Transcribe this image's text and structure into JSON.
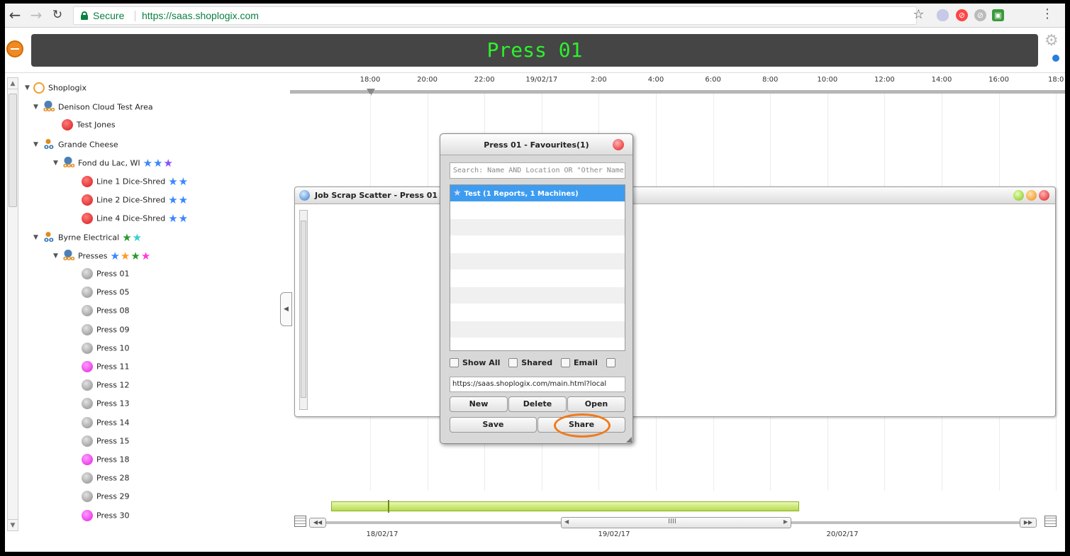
{
  "browser": {
    "secure_label": "Secure",
    "url": "https://saas.shoplogix.com",
    "icons": [
      "back-arrow-icon",
      "forward-arrow-icon",
      "reload-icon",
      "lock-icon",
      "star-icon",
      "menu-icon"
    ]
  },
  "header": {
    "title": "Press 01",
    "title_color": "#2cf22c",
    "bar_color": "#454545"
  },
  "tree": [
    {
      "label": "Shoplogix",
      "icon": "company-icon",
      "toggle": "▼",
      "stars": []
    },
    {
      "label": "Denison Cloud Test Area",
      "icon": "area-icon",
      "toggle": "▼",
      "stars": []
    },
    {
      "label": "Test Jones",
      "icon": "red-status-icon",
      "toggle": "",
      "stars": []
    },
    {
      "label": "Grande Cheese",
      "icon": "group-icon",
      "toggle": "▼",
      "stars": []
    },
    {
      "label": "Fond du Lac, WI",
      "icon": "area-icon",
      "toggle": "▼",
      "stars": [
        "blue",
        "blue",
        "violet"
      ]
    },
    {
      "label": "Line 1 Dice-Shred",
      "icon": "red-status-icon",
      "toggle": "",
      "stars": [
        "blue",
        "blue"
      ]
    },
    {
      "label": "Line 2 Dice-Shred",
      "icon": "red-status-icon",
      "toggle": "",
      "stars": [
        "blue",
        "blue"
      ]
    },
    {
      "label": "Line 4 Dice-Shred",
      "icon": "red-status-icon",
      "toggle": "",
      "stars": [
        "blue",
        "blue"
      ]
    },
    {
      "label": "Byrne Electrical",
      "icon": "group-icon",
      "toggle": "▼",
      "stars": [
        "green",
        "cyan"
      ]
    },
    {
      "label": "Presses",
      "icon": "area-icon",
      "toggle": "▼",
      "stars": [
        "blue",
        "orange",
        "green",
        "pink"
      ]
    },
    {
      "label": "Press 01",
      "icon": "gray-status-icon",
      "toggle": "",
      "stars": []
    },
    {
      "label": "Press 05",
      "icon": "gray-status-icon",
      "toggle": "",
      "stars": []
    },
    {
      "label": "Press 08",
      "icon": "gray-status-icon",
      "toggle": "",
      "stars": []
    },
    {
      "label": "Press 09",
      "icon": "gray-status-icon",
      "toggle": "",
      "stars": []
    },
    {
      "label": "Press 10",
      "icon": "gray-status-icon",
      "toggle": "",
      "stars": []
    },
    {
      "label": "Press 11",
      "icon": "pink-status-icon",
      "toggle": "",
      "stars": []
    },
    {
      "label": "Press 12",
      "icon": "gray-status-icon",
      "toggle": "",
      "stars": []
    },
    {
      "label": "Press 13",
      "icon": "gray-status-icon",
      "toggle": "",
      "stars": []
    },
    {
      "label": "Press 14",
      "icon": "gray-status-icon",
      "toggle": "",
      "stars": []
    },
    {
      "label": "Press 15",
      "icon": "gray-status-icon",
      "toggle": "",
      "stars": []
    },
    {
      "label": "Press 18",
      "icon": "pink-status-icon",
      "toggle": "",
      "stars": []
    },
    {
      "label": "Press 28",
      "icon": "gray-status-icon",
      "toggle": "",
      "stars": []
    },
    {
      "label": "Press 29",
      "icon": "gray-status-icon",
      "toggle": "",
      "stars": []
    },
    {
      "label": "Press 30",
      "icon": "pink-status-icon",
      "toggle": "",
      "stars": []
    }
  ],
  "timeline": {
    "ticks": [
      "18:00",
      "20:00",
      "22:00",
      "19/02/17",
      "2:00",
      "4:00",
      "6:00",
      "8:00",
      "10:00",
      "12:00",
      "14:00",
      "16:00",
      "18:0"
    ]
  },
  "scatter_window": {
    "title": "Job Scrap Scatter - Press 01"
  },
  "favourites": {
    "title": "Press 01 - Favourites(1)",
    "search_placeholder": "Search: Name AND Location OR \"Other Names\"",
    "items": [
      "Test (1 Reports, 1 Machines)",
      "",
      "",
      "",
      "",
      "",
      "",
      "",
      "",
      ""
    ],
    "options": {
      "show_all": "Show All",
      "shared": "Shared",
      "email": "Email"
    },
    "share_url": "https://saas.shoplogix.com/main.html?local",
    "buttons": {
      "new": "New",
      "delete": "Delete",
      "open": "Open",
      "save": "Save",
      "share": "Share"
    },
    "highlight_color": "#f07a1c"
  },
  "range": {
    "dates": [
      "18/02/17",
      "19/02/17",
      "20/02/17"
    ],
    "bar_color": "#b8dc4c"
  }
}
